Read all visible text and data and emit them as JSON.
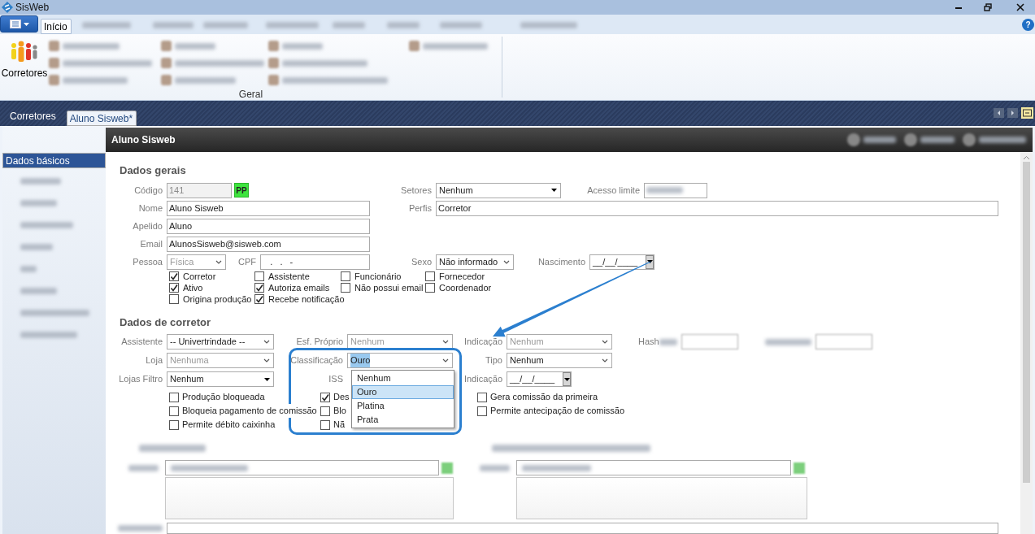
{
  "window": {
    "title": "SisWeb",
    "help": "?"
  },
  "ribbon": {
    "tabs": [
      {
        "label": "Início",
        "selected": true
      }
    ],
    "big_button": {
      "label": "Corretores"
    },
    "group_label": "Geral"
  },
  "document_tabs": [
    {
      "label": "Corretores",
      "selected": false
    },
    {
      "label": "Aluno Sisweb*",
      "selected": true
    }
  ],
  "sidebar": {
    "items": [
      {
        "label": "Dados básicos",
        "selected": true
      }
    ]
  },
  "panel": {
    "title": "Aluno Sisweb"
  },
  "dados_gerais": {
    "heading": "Dados gerais",
    "codigo": {
      "label": "Código",
      "value": "141",
      "disabled": true
    },
    "badge": "PP",
    "setores": {
      "label": "Setores",
      "value": "Nenhum",
      "disabled": false
    },
    "acesso_limite": {
      "label": "Acesso limite"
    },
    "nome": {
      "label": "Nome",
      "value": "Aluno Sisweb",
      "disabled": false
    },
    "perfis": {
      "label": "Perfis",
      "value": "Corretor",
      "disabled": false
    },
    "apelido": {
      "label": "Apelido",
      "value": "Aluno",
      "disabled": false
    },
    "email": {
      "label": "Email",
      "value": "AlunosSisweb@sisweb.com",
      "disabled": false
    },
    "pessoa": {
      "label": "Pessoa",
      "value": "Física",
      "disabled": true
    },
    "cpf": {
      "label": "CPF",
      "value": "   .   .   -",
      "disabled": false
    },
    "sexo": {
      "label": "Sexo",
      "value": "Não informado",
      "disabled": false
    },
    "nascimento": {
      "label": "Nascimento",
      "value": "__/__/____"
    },
    "checkboxes": [
      {
        "label": "Corretor",
        "checked": true
      },
      {
        "label": "Assistente",
        "checked": false
      },
      {
        "label": "Funcionário",
        "checked": false
      },
      {
        "label": "Fornecedor",
        "checked": false
      },
      {
        "label": "Ativo",
        "checked": true
      },
      {
        "label": "Autoriza emails",
        "checked": true
      },
      {
        "label": "Não possui email",
        "checked": false
      },
      {
        "label": "Coordenador",
        "checked": false
      },
      {
        "label": "Origina produção",
        "checked": false
      },
      {
        "label": "Recebe notificação",
        "checked": true
      }
    ]
  },
  "dados_corretor": {
    "heading": "Dados de corretor",
    "assistente": {
      "label": "Assistente",
      "value": "-- Univertrindade --",
      "disabled": false
    },
    "esf_proprio": {
      "label": "Esf. Próprio",
      "value": "Nenhum",
      "disabled": true
    },
    "indicacao": {
      "label": "Indicação",
      "value": "Nenhum",
      "disabled": true
    },
    "hash_label": "Hash",
    "loja": {
      "label": "Loja",
      "value": "Nenhuma",
      "disabled": true
    },
    "classificacao": {
      "label": "Classificação",
      "value": "Ouro",
      "disabled": false,
      "expanded": true,
      "options": [
        {
          "label": "Nenhum",
          "selected": false
        },
        {
          "label": "Ouro",
          "selected": true
        },
        {
          "label": "Platina",
          "selected": false
        },
        {
          "label": "Prata",
          "selected": false
        }
      ]
    },
    "tipo": {
      "label": "Tipo",
      "value": "Nenhum",
      "disabled": false
    },
    "lojas_filtro": {
      "label": "Lojas Filtro",
      "value": "Nenhum",
      "disabled": false
    },
    "iss": {
      "label": "ISS"
    },
    "indicacao_data": {
      "label": "Indicação",
      "value": "__/__/____"
    },
    "checkboxes": [
      {
        "label": "Produção bloqueada",
        "checked": false
      },
      {
        "label": "Des",
        "checked": true
      },
      {
        "label": "Gera comissão da primeira",
        "checked": false
      },
      {
        "label": "Bloqueia pagamento de comissão",
        "checked": false
      },
      {
        "label": "Blo",
        "checked": false
      },
      {
        "label": "Permite antecipação de comissão",
        "checked": false
      },
      {
        "label": "Permite débito caixinha",
        "checked": false
      },
      {
        "label": "Nã",
        "checked": false
      }
    ]
  }
}
